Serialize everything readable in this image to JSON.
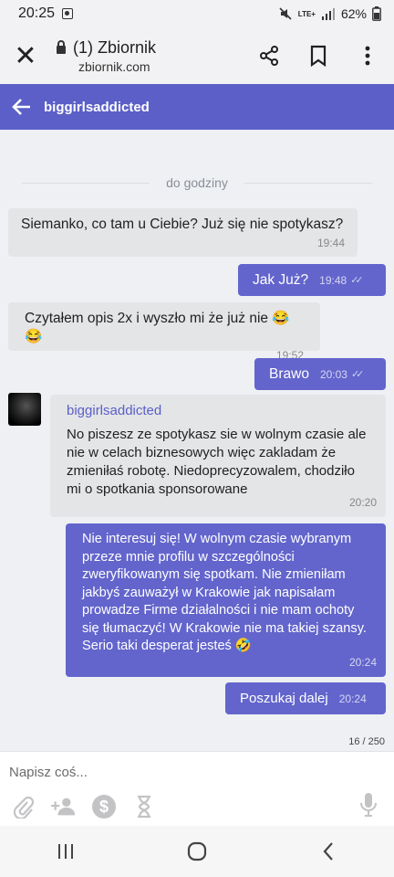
{
  "status_bar": {
    "time": "20:25",
    "battery": "62%",
    "network": "LTE+"
  },
  "browser": {
    "page_title": "(1) Zbiornik",
    "domain": "zbiornik.com"
  },
  "header": {
    "title": "biggirlsaddicted"
  },
  "divider": {
    "label": "do godziny"
  },
  "messages": [
    {
      "direction": "in",
      "text": "Siemanko, co tam u Ciebie? Już się nie spotykasz?",
      "time": "19:44"
    },
    {
      "direction": "out",
      "text": "Jak Już?",
      "time": "19:48"
    },
    {
      "direction": "in",
      "text": "Czytałem opis 2x i wyszło mi że już nie 😂😂",
      "time": "19:52"
    },
    {
      "direction": "out",
      "text": "Brawo",
      "time": "20:03"
    },
    {
      "direction": "in",
      "sender": "biggirlsaddicted",
      "text": "No piszesz ze spotykasz sie w wolnym czasie ale nie w celach biznesowych więc zakladam że zmieniłaś robotę. Niedoprecyzowalem, chodziło mi o spotkania sponsorowane",
      "time": "20:20"
    },
    {
      "direction": "out",
      "text": "Nie interesuj się! W wolnym czasie wybranym przeze mnie profilu w szczególności zweryfikowanym się spotkam. Nie zmieniłam jakbyś zauważył w Krakowie jak napisałam prowadze Firme działalności i nie mam ochoty się tłumaczyć! W Krakowie nie ma takiej szansy. Serio taki desperat jesteś 🤣",
      "time": "20:24"
    },
    {
      "direction": "out",
      "text": "Poszukaj dalej",
      "time": "20:24"
    }
  ],
  "composer": {
    "placeholder": "Napisz coś...",
    "counter": "16 / 250"
  },
  "colors": {
    "accent": "#5b5fc7",
    "outgoing_bubble": "#6365cc",
    "incoming_bubble": "#e4e5e7"
  },
  "icons": [
    "close-icon",
    "lock-icon",
    "share-icon",
    "bookmark-icon",
    "more-vert-icon",
    "back-arrow-icon",
    "paperclip-icon",
    "add-person-icon",
    "dollar-icon",
    "hourglass-icon",
    "microphone-icon",
    "nav-recents-icon",
    "nav-home-icon",
    "nav-back-icon"
  ]
}
